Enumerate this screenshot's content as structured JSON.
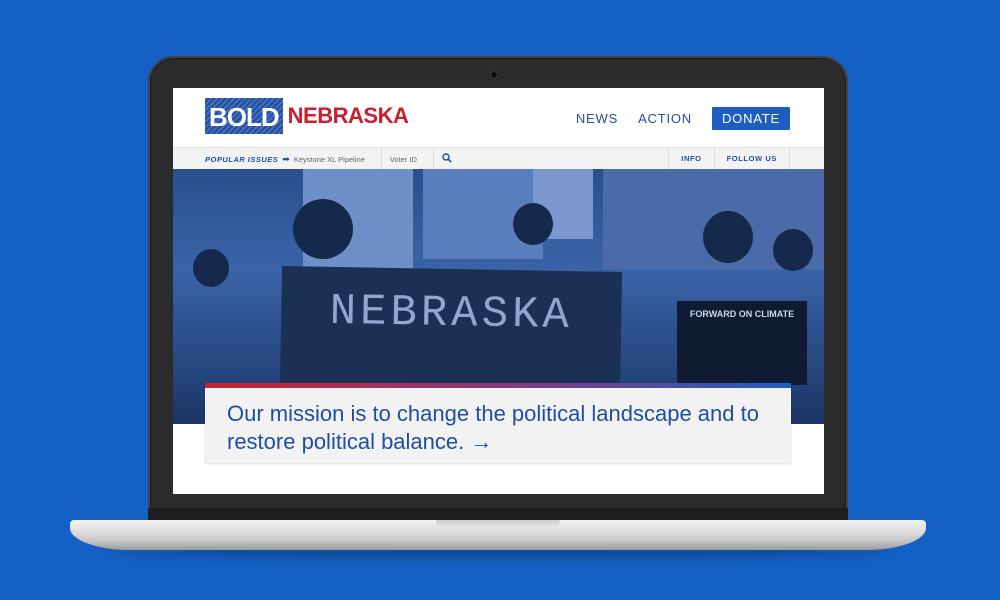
{
  "logo": {
    "bold": "BOLD",
    "nebraska": "NEBRASKA"
  },
  "nav": {
    "news": "NEWS",
    "action": "ACTION",
    "donate": "DONATE"
  },
  "subbar": {
    "popular_label": "POPULAR ISSUES",
    "issues": [
      "Keystone XL Pipeline",
      "Voter ID"
    ],
    "info": "INFO",
    "follow": "FOLLOW US"
  },
  "hero": {
    "banner_text": "NEBRASKA",
    "sign_text": "FORWARD ON CLIMATE"
  },
  "mission": {
    "text": "Our mission is to change the political landscape and to restore political balance. →"
  },
  "colors": {
    "background": "#1560c4",
    "brand_blue": "#1f4ea3",
    "brand_red": "#c8202f"
  }
}
